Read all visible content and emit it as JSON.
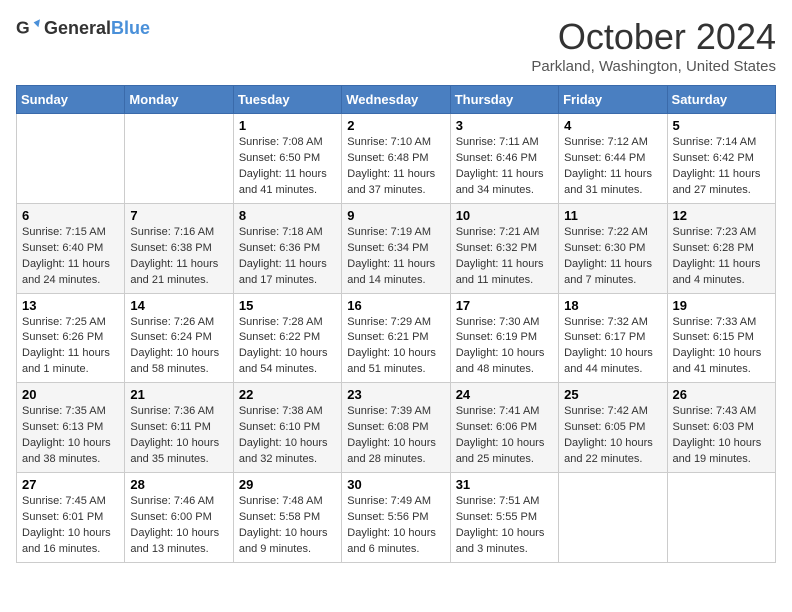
{
  "header": {
    "logo_general": "General",
    "logo_blue": "Blue",
    "month": "October 2024",
    "location": "Parkland, Washington, United States"
  },
  "days_of_week": [
    "Sunday",
    "Monday",
    "Tuesday",
    "Wednesday",
    "Thursday",
    "Friday",
    "Saturday"
  ],
  "weeks": [
    [
      {
        "day": "",
        "info": ""
      },
      {
        "day": "",
        "info": ""
      },
      {
        "day": "1",
        "info": "Sunrise: 7:08 AM\nSunset: 6:50 PM\nDaylight: 11 hours and 41 minutes."
      },
      {
        "day": "2",
        "info": "Sunrise: 7:10 AM\nSunset: 6:48 PM\nDaylight: 11 hours and 37 minutes."
      },
      {
        "day": "3",
        "info": "Sunrise: 7:11 AM\nSunset: 6:46 PM\nDaylight: 11 hours and 34 minutes."
      },
      {
        "day": "4",
        "info": "Sunrise: 7:12 AM\nSunset: 6:44 PM\nDaylight: 11 hours and 31 minutes."
      },
      {
        "day": "5",
        "info": "Sunrise: 7:14 AM\nSunset: 6:42 PM\nDaylight: 11 hours and 27 minutes."
      }
    ],
    [
      {
        "day": "6",
        "info": "Sunrise: 7:15 AM\nSunset: 6:40 PM\nDaylight: 11 hours and 24 minutes."
      },
      {
        "day": "7",
        "info": "Sunrise: 7:16 AM\nSunset: 6:38 PM\nDaylight: 11 hours and 21 minutes."
      },
      {
        "day": "8",
        "info": "Sunrise: 7:18 AM\nSunset: 6:36 PM\nDaylight: 11 hours and 17 minutes."
      },
      {
        "day": "9",
        "info": "Sunrise: 7:19 AM\nSunset: 6:34 PM\nDaylight: 11 hours and 14 minutes."
      },
      {
        "day": "10",
        "info": "Sunrise: 7:21 AM\nSunset: 6:32 PM\nDaylight: 11 hours and 11 minutes."
      },
      {
        "day": "11",
        "info": "Sunrise: 7:22 AM\nSunset: 6:30 PM\nDaylight: 11 hours and 7 minutes."
      },
      {
        "day": "12",
        "info": "Sunrise: 7:23 AM\nSunset: 6:28 PM\nDaylight: 11 hours and 4 minutes."
      }
    ],
    [
      {
        "day": "13",
        "info": "Sunrise: 7:25 AM\nSunset: 6:26 PM\nDaylight: 11 hours and 1 minute."
      },
      {
        "day": "14",
        "info": "Sunrise: 7:26 AM\nSunset: 6:24 PM\nDaylight: 10 hours and 58 minutes."
      },
      {
        "day": "15",
        "info": "Sunrise: 7:28 AM\nSunset: 6:22 PM\nDaylight: 10 hours and 54 minutes."
      },
      {
        "day": "16",
        "info": "Sunrise: 7:29 AM\nSunset: 6:21 PM\nDaylight: 10 hours and 51 minutes."
      },
      {
        "day": "17",
        "info": "Sunrise: 7:30 AM\nSunset: 6:19 PM\nDaylight: 10 hours and 48 minutes."
      },
      {
        "day": "18",
        "info": "Sunrise: 7:32 AM\nSunset: 6:17 PM\nDaylight: 10 hours and 44 minutes."
      },
      {
        "day": "19",
        "info": "Sunrise: 7:33 AM\nSunset: 6:15 PM\nDaylight: 10 hours and 41 minutes."
      }
    ],
    [
      {
        "day": "20",
        "info": "Sunrise: 7:35 AM\nSunset: 6:13 PM\nDaylight: 10 hours and 38 minutes."
      },
      {
        "day": "21",
        "info": "Sunrise: 7:36 AM\nSunset: 6:11 PM\nDaylight: 10 hours and 35 minutes."
      },
      {
        "day": "22",
        "info": "Sunrise: 7:38 AM\nSunset: 6:10 PM\nDaylight: 10 hours and 32 minutes."
      },
      {
        "day": "23",
        "info": "Sunrise: 7:39 AM\nSunset: 6:08 PM\nDaylight: 10 hours and 28 minutes."
      },
      {
        "day": "24",
        "info": "Sunrise: 7:41 AM\nSunset: 6:06 PM\nDaylight: 10 hours and 25 minutes."
      },
      {
        "day": "25",
        "info": "Sunrise: 7:42 AM\nSunset: 6:05 PM\nDaylight: 10 hours and 22 minutes."
      },
      {
        "day": "26",
        "info": "Sunrise: 7:43 AM\nSunset: 6:03 PM\nDaylight: 10 hours and 19 minutes."
      }
    ],
    [
      {
        "day": "27",
        "info": "Sunrise: 7:45 AM\nSunset: 6:01 PM\nDaylight: 10 hours and 16 minutes."
      },
      {
        "day": "28",
        "info": "Sunrise: 7:46 AM\nSunset: 6:00 PM\nDaylight: 10 hours and 13 minutes."
      },
      {
        "day": "29",
        "info": "Sunrise: 7:48 AM\nSunset: 5:58 PM\nDaylight: 10 hours and 9 minutes."
      },
      {
        "day": "30",
        "info": "Sunrise: 7:49 AM\nSunset: 5:56 PM\nDaylight: 10 hours and 6 minutes."
      },
      {
        "day": "31",
        "info": "Sunrise: 7:51 AM\nSunset: 5:55 PM\nDaylight: 10 hours and 3 minutes."
      },
      {
        "day": "",
        "info": ""
      },
      {
        "day": "",
        "info": ""
      }
    ]
  ]
}
